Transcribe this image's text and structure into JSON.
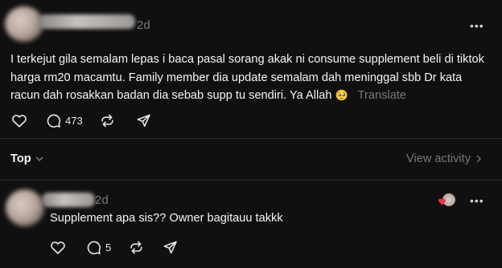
{
  "post": {
    "time": "2d",
    "text": "I terkejut gila semalam lepas i baca pasal sorang akak ni consume supplement beli di tiktok harga rm20 macamtu. Family member dia update semalam dah meninggal sbb Dr kata racun dah rosakkan badan dia sebab supp tu sendiri. Ya Allah",
    "emoji": "🥺",
    "translate_label": "Translate",
    "reply_count": "473"
  },
  "sort": {
    "label": "Top",
    "view_activity_label": "View activity"
  },
  "reply": {
    "time": "2d",
    "text": "Supplement apa sis?? Owner bagitauu takkk",
    "reply_count": "5"
  },
  "icons": {
    "more": "more-horizontal-icon",
    "like": "heart-icon",
    "comment": "speech-bubble-icon",
    "repost": "repost-icon",
    "share": "send-icon",
    "chevron_down": "chevron-down-icon",
    "chevron_right": "chevron-right-icon"
  },
  "colors": {
    "background": "#101010",
    "text": "#f3f5f7",
    "muted": "#777777",
    "divider": "#2d2d2d",
    "like_red": "#ff3040"
  }
}
